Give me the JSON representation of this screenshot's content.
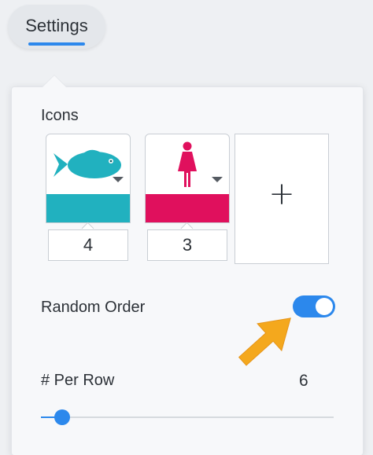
{
  "header": {
    "settings_tab_label": "Settings"
  },
  "icons_section": {
    "label": "Icons",
    "items": [
      {
        "icon": "fish-icon",
        "color": "#21b1bf",
        "count": "4"
      },
      {
        "icon": "woman-icon",
        "color": "#e0105d",
        "count": "3"
      }
    ],
    "add_label": "+"
  },
  "random_order": {
    "label": "Random Order",
    "enabled": true
  },
  "per_row": {
    "label": "# Per Row",
    "value": "6",
    "slider_fraction": 0.04
  },
  "colors": {
    "accent": "#2c88ec",
    "pointer_arrow": "#f4a81d"
  }
}
